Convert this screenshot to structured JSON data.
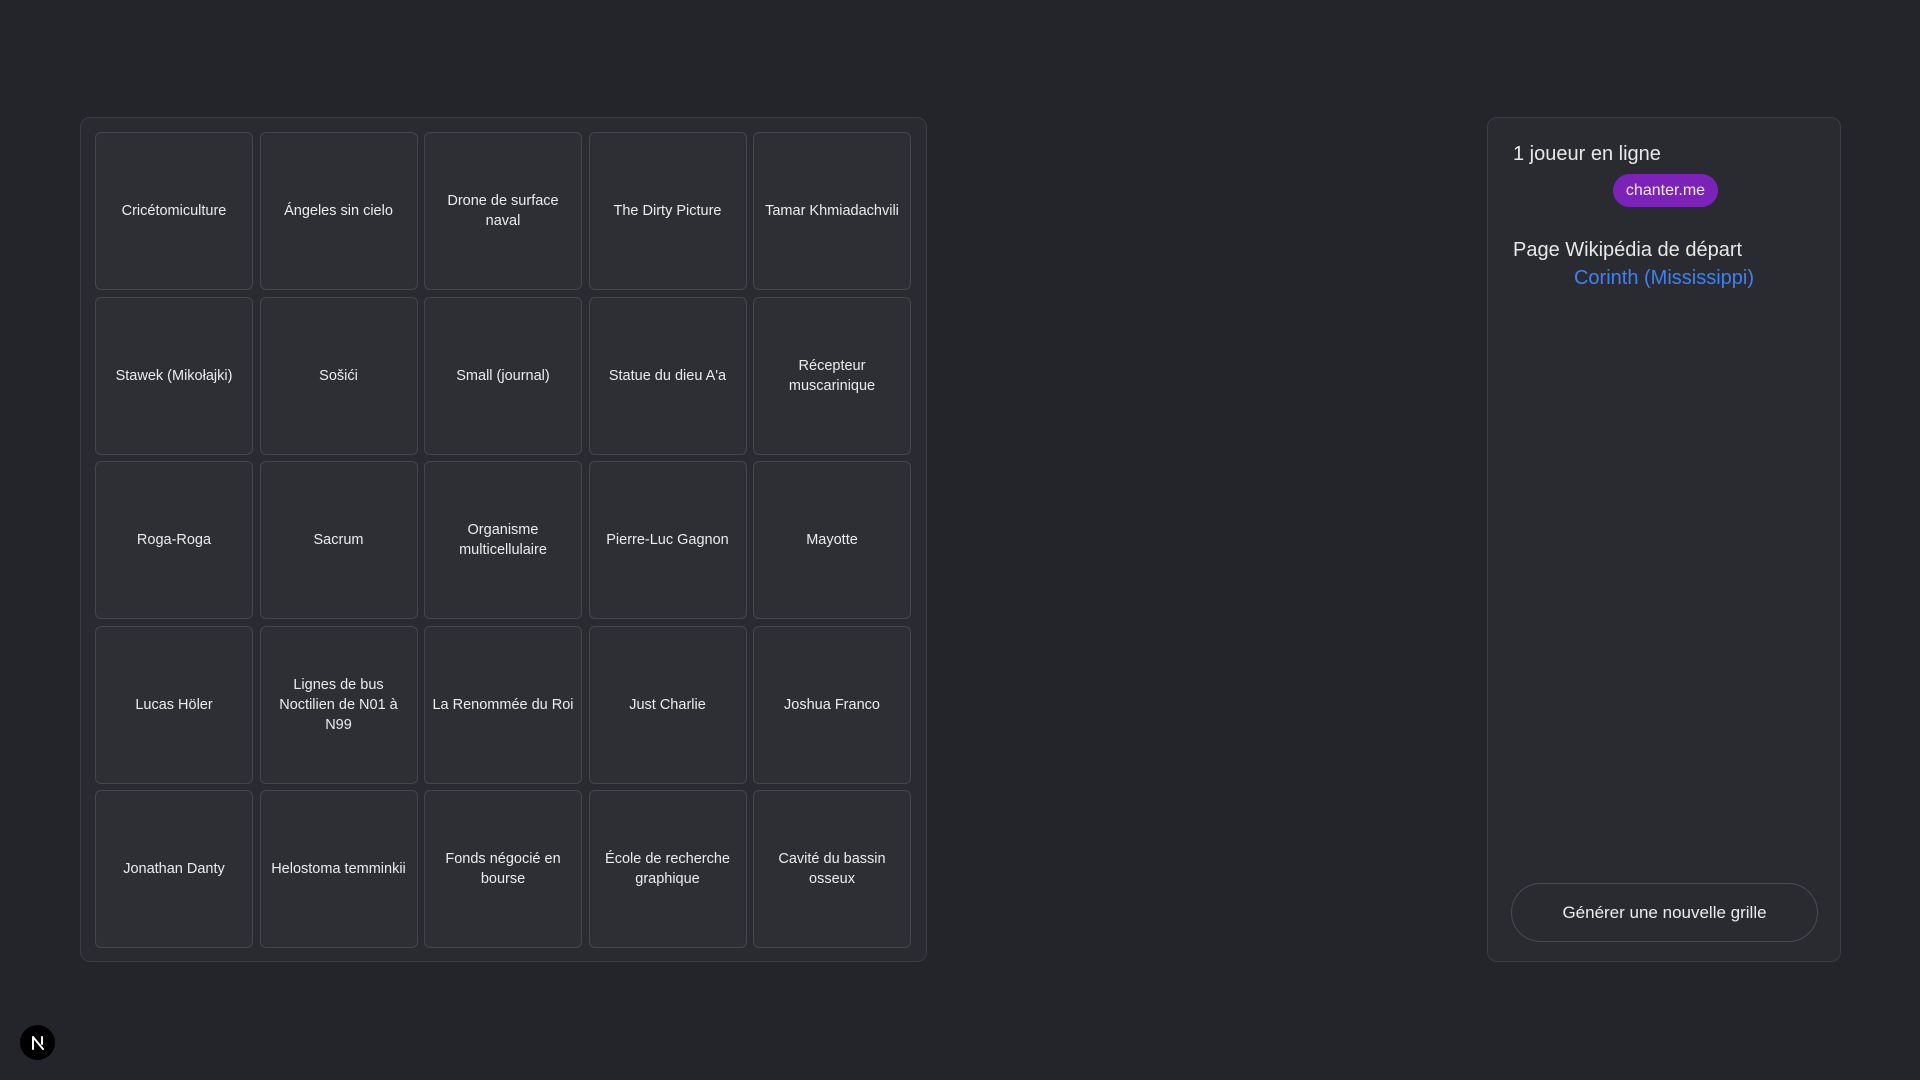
{
  "grid": {
    "cells": [
      "Cricétomiculture",
      "Ángeles sin cielo",
      "Drone de surface naval",
      "The Dirty Picture",
      "Tamar Khmiadachvili",
      "Stawek (Mikołajki)",
      "Sošići",
      "Small (journal)",
      "Statue du dieu A'a",
      "Récepteur muscarinique",
      "Roga-Roga",
      "Sacrum",
      "Organisme multicellulaire",
      "Pierre-Luc Gagnon",
      "Mayotte",
      "Lucas Höler",
      "Lignes de bus Noctilien de N01 à N99",
      "La Renommée du Roi",
      "Just Charlie",
      "Joshua Franco",
      "Jonathan Danty",
      "Helostoma temminkii",
      "Fonds négocié en bourse",
      "École de recherche graphique",
      "Cavité du bassin osseux"
    ]
  },
  "sidebar": {
    "players_title": "1 joueur en ligne",
    "player_name": "chanter.me",
    "start_title": "Page Wikipédia de départ",
    "start_page": "Corinth (Mississippi)",
    "generate_button": "Générer une nouvelle grille"
  },
  "dev_badge": {
    "icon": "nextjs-logo-icon"
  },
  "colors": {
    "background": "#24252b",
    "panel": "#2a2b31",
    "cell": "#2e2f35",
    "badge": "#7b22b8",
    "link": "#3b82f6"
  }
}
